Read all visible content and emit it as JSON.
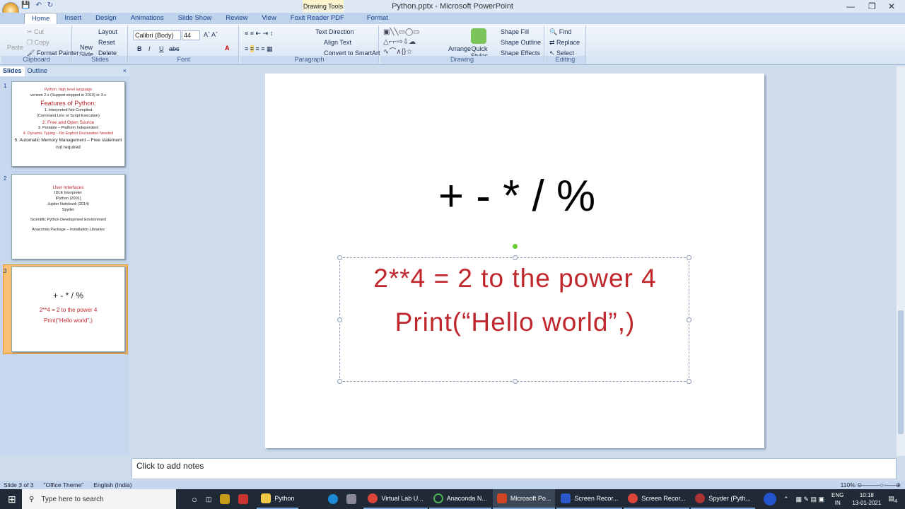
{
  "window": {
    "title": "Python.pptx - Microsoft PowerPoint",
    "contextual_tab": "Drawing Tools"
  },
  "tabs": [
    "Home",
    "Insert",
    "Design",
    "Animations",
    "Slide Show",
    "Review",
    "View",
    "Foxit Reader PDF",
    "Format"
  ],
  "ribbon": {
    "clipboard": {
      "label": "Clipboard",
      "paste": "Paste",
      "cut": "Cut",
      "copy": "Copy",
      "format_painter": "Format Painter"
    },
    "slides": {
      "label": "Slides",
      "new_slide": "New Slide",
      "layout": "Layout",
      "reset": "Reset",
      "delete": "Delete"
    },
    "font": {
      "label": "Font",
      "font_name": "Calibri (Body)",
      "font_size": "44"
    },
    "paragraph": {
      "label": "Paragraph",
      "text_direction": "Text Direction",
      "align_text": "Align Text",
      "convert": "Convert to SmartArt"
    },
    "drawing": {
      "label": "Drawing",
      "arrange": "Arrange",
      "quick_styles": "Quick Styles",
      "shape_fill": "Shape Fill",
      "shape_outline": "Shape Outline",
      "shape_effects": "Shape Effects"
    },
    "editing": {
      "label": "Editing",
      "find": "Find",
      "replace": "Replace",
      "select": "Select"
    }
  },
  "pane": {
    "tabs": [
      "Slides",
      "Outline"
    ],
    "thumbs": [
      {
        "num": "1",
        "lines": [
          "Python: high level language",
          "version 2.x (Support stopped in 2010) or 3.x",
          "Features of Python:",
          "1. Interpreted Not Compiled",
          "(Command Line or Script Execution)",
          "2. Free and Open Source",
          "3. Portable – Platform Independent",
          "4. Dynamic Typing – No Explicit Declaration Needed",
          "5. Automatic Memory Management – Free statement not required"
        ]
      },
      {
        "num": "2",
        "lines": [
          "User Interfaces",
          "IDLE Interpreter",
          "IPython (2001)",
          "Jupiter Notebook (2014)",
          "Spyder",
          "Scientific Python Development Environment",
          "Anaconda Package – Installation Libraries"
        ]
      },
      {
        "num": "3",
        "lines": [
          "+ - * / %",
          "2**4 = 2 to the power 4",
          "Print(“Hello world”,)"
        ]
      }
    ]
  },
  "slide": {
    "operators": "+ - * / %",
    "line1": "2**4 = 2 to the power 4",
    "line2": "Print(“Hello world”,)"
  },
  "notes": {
    "placeholder": "Click to add notes"
  },
  "status": {
    "slide": "Slide 3 of 3",
    "theme": "\"Office Theme\"",
    "language": "English (India)",
    "zoom": "110%"
  },
  "taskbar": {
    "search": "Type here to search",
    "items": [
      "Python",
      "Virtual Lab U...",
      "Anaconda N...",
      "Microsoft Po...",
      "Screen Recor...",
      "Screen Recor...",
      "Spyder (Pyth..."
    ],
    "lang": "ENG",
    "region": "IN",
    "time": "10:18",
    "date": "13-01-2021",
    "notif": "4"
  },
  "colors": {
    "accent_red": "#c0272d",
    "ribbon": "#d7e4f3",
    "taskbar": "#1f2a36"
  }
}
